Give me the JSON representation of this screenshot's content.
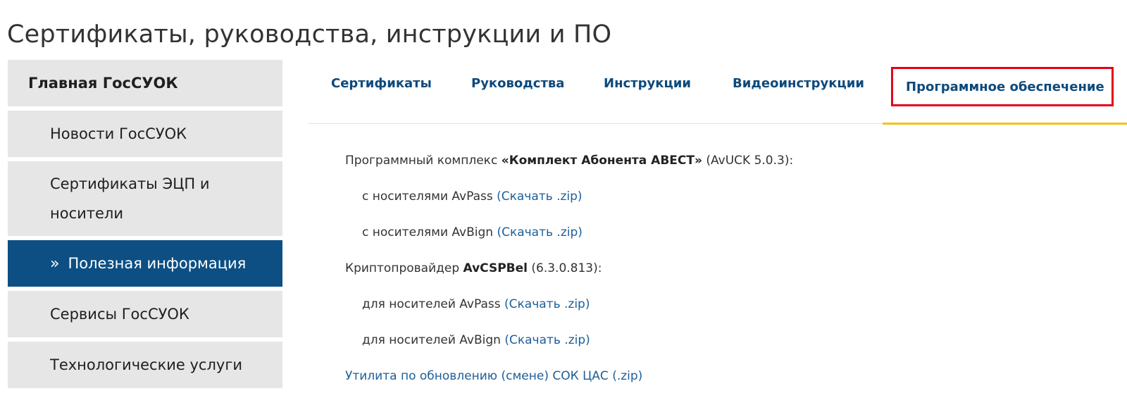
{
  "page": {
    "title": "Сертификаты, руководства, инструкции и ПО"
  },
  "sidebar": {
    "items": [
      {
        "label": "Главная ГосСУОК"
      },
      {
        "label": "Новости ГосСУОК"
      },
      {
        "label": "Сертификаты ЭЦП и носители"
      },
      {
        "label": "Полезная информация",
        "chevron": "»"
      },
      {
        "label": "Сервисы ГосСУОК"
      },
      {
        "label": "Технологические услуги"
      }
    ]
  },
  "tabs": [
    {
      "label": "Сертификаты"
    },
    {
      "label": "Руководства"
    },
    {
      "label": "Инструкции"
    },
    {
      "label": "Видеоинструкции"
    },
    {
      "label": "Программное обеспечение"
    }
  ],
  "content": {
    "avuck": {
      "prefix": "Программный комплекс ",
      "name": "«Комплект Абонента АВЕСТ»",
      "suffix": " (AvUCK 5.0.3):",
      "avpass_text": "с носителями AvPass ",
      "avpass_link": "(Скачать .zip)",
      "avbign_text": "с носителями AvBign ",
      "avbign_link": "(Скачать .zip)"
    },
    "avcsp": {
      "prefix": "Криптопровайдер ",
      "name": "AvCSPBel",
      "suffix": " (6.3.0.813):",
      "avpass_text": "для носителей AvPass ",
      "avpass_link": "(Скачать .zip)",
      "avbign_text": "для носителей AvBign ",
      "avbign_link": "(Скачать .zip)"
    },
    "utility_link": "Утилита по обновлению (смене) СОК ЦАС (.zip)"
  },
  "colors": {
    "accent_blue": "#0d4f83",
    "link_blue": "#1d5e99",
    "highlight_red": "#e5001a",
    "tab_underline_yellow": "#f2c31a"
  }
}
